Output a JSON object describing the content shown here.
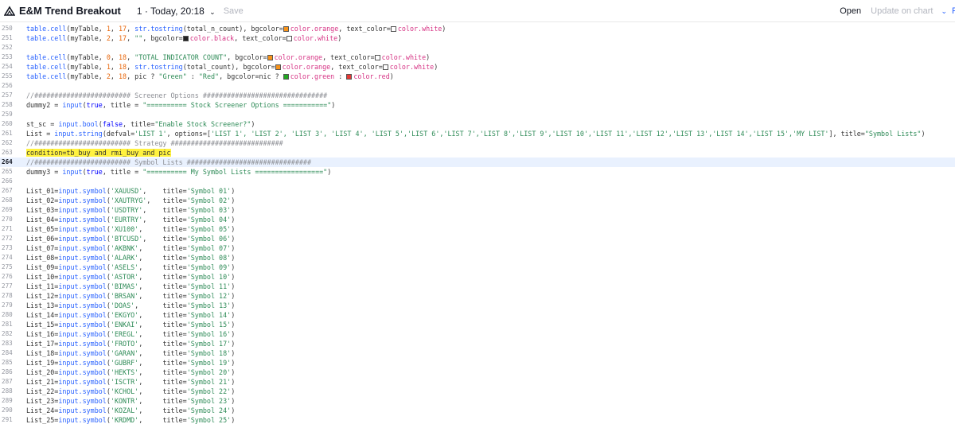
{
  "header": {
    "script_name": "E&M Trend Breakout",
    "version": "1 · Today, 20:18",
    "chevron": "⌄",
    "save_label": "Save",
    "open_label": "Open",
    "update_label": "Update on chart",
    "chevron2": "⌄",
    "publish_label": "P"
  },
  "colors": {
    "accent": "#2962ff",
    "highlight": "#fff23f",
    "current_line": "#e9f1fe"
  },
  "lines": [
    {
      "n": "250",
      "segs": [
        {
          "t": "table.cell",
          "c": "fn"
        },
        {
          "t": "(myTable, "
        },
        {
          "t": "1",
          "c": "num"
        },
        {
          "t": ", "
        },
        {
          "t": "17",
          "c": "num"
        },
        {
          "t": ", "
        },
        {
          "t": "str.tostring",
          "c": "fn"
        },
        {
          "t": "(total_n_count), bgcolor="
        },
        {
          "sw": "orange"
        },
        {
          "t": "color.orange",
          "c": "cv"
        },
        {
          "t": ", text_color="
        },
        {
          "sw": "white"
        },
        {
          "t": "color.white",
          "c": "cv"
        },
        {
          "t": ")"
        }
      ]
    },
    {
      "n": "251",
      "segs": [
        {
          "t": "table.cell",
          "c": "fn"
        },
        {
          "t": "(myTable, "
        },
        {
          "t": "2",
          "c": "num"
        },
        {
          "t": ", "
        },
        {
          "t": "17",
          "c": "num"
        },
        {
          "t": ", "
        },
        {
          "t": "\"\"",
          "c": "str"
        },
        {
          "t": ", bgcolor="
        },
        {
          "sw": "black"
        },
        {
          "t": "color.black",
          "c": "cv"
        },
        {
          "t": ", text_color="
        },
        {
          "sw": "white"
        },
        {
          "t": "color.white",
          "c": "cv"
        },
        {
          "t": ")"
        }
      ]
    },
    {
      "n": "252",
      "segs": []
    },
    {
      "n": "253",
      "segs": [
        {
          "t": "table.cell",
          "c": "fn"
        },
        {
          "t": "(myTable, "
        },
        {
          "t": "0",
          "c": "num"
        },
        {
          "t": ", "
        },
        {
          "t": "18",
          "c": "num"
        },
        {
          "t": ", "
        },
        {
          "t": "\"TOTAL INDICATOR COUNT\"",
          "c": "str"
        },
        {
          "t": ", bgcolor="
        },
        {
          "sw": "orange"
        },
        {
          "t": "color.orange",
          "c": "cv"
        },
        {
          "t": ", text_color="
        },
        {
          "sw": "white"
        },
        {
          "t": "color.white",
          "c": "cv"
        },
        {
          "t": ")"
        }
      ]
    },
    {
      "n": "254",
      "segs": [
        {
          "t": "table.cell",
          "c": "fn"
        },
        {
          "t": "(myTable, "
        },
        {
          "t": "1",
          "c": "num"
        },
        {
          "t": ", "
        },
        {
          "t": "18",
          "c": "num"
        },
        {
          "t": ", "
        },
        {
          "t": "str.tostring",
          "c": "fn"
        },
        {
          "t": "(total_count), bgcolor="
        },
        {
          "sw": "orange"
        },
        {
          "t": "color.orange",
          "c": "cv"
        },
        {
          "t": ", text_color="
        },
        {
          "sw": "white"
        },
        {
          "t": "color.white",
          "c": "cv"
        },
        {
          "t": ")"
        }
      ]
    },
    {
      "n": "255",
      "segs": [
        {
          "t": "table.cell",
          "c": "fn"
        },
        {
          "t": "(myTable, "
        },
        {
          "t": "2",
          "c": "num"
        },
        {
          "t": ", "
        },
        {
          "t": "18",
          "c": "num"
        },
        {
          "t": ", pic ? "
        },
        {
          "t": "\"Green\"",
          "c": "str"
        },
        {
          "t": " : "
        },
        {
          "t": "\"Red\"",
          "c": "str"
        },
        {
          "t": ", bgcolor=nic ? "
        },
        {
          "sw": "green"
        },
        {
          "t": "color.green",
          "c": "cv"
        },
        {
          "t": " : "
        },
        {
          "sw": "red"
        },
        {
          "t": "color.red",
          "c": "cv"
        },
        {
          "t": ")"
        }
      ]
    },
    {
      "n": "256",
      "segs": []
    },
    {
      "n": "257",
      "segs": [
        {
          "t": "//######################## Screener Options ###############################",
          "c": "cmt"
        }
      ]
    },
    {
      "n": "258",
      "segs": [
        {
          "t": "dummy2 = "
        },
        {
          "t": "input",
          "c": "fn"
        },
        {
          "t": "("
        },
        {
          "t": "true",
          "c": "kw"
        },
        {
          "t": ", title = "
        },
        {
          "t": "\"========== Stock Screener Options ===========\"",
          "c": "str"
        },
        {
          "t": ")"
        }
      ]
    },
    {
      "n": "259",
      "segs": []
    },
    {
      "n": "260",
      "segs": [
        {
          "t": "st_sc = "
        },
        {
          "t": "input.bool",
          "c": "fn"
        },
        {
          "t": "("
        },
        {
          "t": "false",
          "c": "kw"
        },
        {
          "t": ", title="
        },
        {
          "t": "\"Enable Stock Screener?\"",
          "c": "str"
        },
        {
          "t": ")"
        }
      ]
    },
    {
      "n": "261",
      "segs": [
        {
          "t": "List = "
        },
        {
          "t": "input.string",
          "c": "fn"
        },
        {
          "t": "(defval="
        },
        {
          "t": "'LIST 1'",
          "c": "str"
        },
        {
          "t": ", options=["
        },
        {
          "t": "'LIST 1', 'LIST 2', 'LIST 3', 'LIST 4', 'LIST 5','LIST 6','LIST 7','LIST 8','LIST 9','LIST 10','LIST 11','LIST 12','LIST 13','LIST 14','LIST 15','MY LIST'",
          "c": "str"
        },
        {
          "t": "], title="
        },
        {
          "t": "\"Symbol Lists\"",
          "c": "str"
        },
        {
          "t": ")"
        }
      ]
    },
    {
      "n": "262",
      "segs": [
        {
          "t": "//######################## Strategy ############################",
          "c": "cmt"
        }
      ]
    },
    {
      "n": "263",
      "segs": [
        {
          "t": "condition=tb_buy and rmi_buy and pic",
          "c": "hl"
        }
      ]
    },
    {
      "n": "264",
      "current": true,
      "segs": [
        {
          "t": "//######################## Symbol Lists ###############################",
          "c": "cmt"
        }
      ]
    },
    {
      "n": "265",
      "segs": [
        {
          "t": "dummy3 = "
        },
        {
          "t": "input",
          "c": "fn"
        },
        {
          "t": "("
        },
        {
          "t": "true",
          "c": "kw"
        },
        {
          "t": ", title = "
        },
        {
          "t": "\"========== My Symbol Lists =================\"",
          "c": "str"
        },
        {
          "t": ")"
        }
      ]
    },
    {
      "n": "266",
      "segs": []
    },
    {
      "n": "267",
      "segs": [
        {
          "t": "List_01="
        },
        {
          "t": "input.symbol",
          "c": "fn"
        },
        {
          "t": "("
        },
        {
          "t": "'XAUUSD'",
          "c": "str"
        },
        {
          "t": ",    title="
        },
        {
          "t": "'Symbol 01'",
          "c": "str"
        },
        {
          "t": ")"
        }
      ]
    },
    {
      "n": "268",
      "segs": [
        {
          "t": "List_02="
        },
        {
          "t": "input.symbol",
          "c": "fn"
        },
        {
          "t": "("
        },
        {
          "t": "'XAUTRYG'",
          "c": "str"
        },
        {
          "t": ",   title="
        },
        {
          "t": "'Symbol 02'",
          "c": "str"
        },
        {
          "t": ")"
        }
      ]
    },
    {
      "n": "269",
      "segs": [
        {
          "t": "List_03="
        },
        {
          "t": "input.symbol",
          "c": "fn"
        },
        {
          "t": "("
        },
        {
          "t": "'USDTRY'",
          "c": "str"
        },
        {
          "t": ",    title="
        },
        {
          "t": "'Symbol 03'",
          "c": "str"
        },
        {
          "t": ")"
        }
      ]
    },
    {
      "n": "270",
      "segs": [
        {
          "t": "List_04="
        },
        {
          "t": "input.symbol",
          "c": "fn"
        },
        {
          "t": "("
        },
        {
          "t": "'EURTRY'",
          "c": "str"
        },
        {
          "t": ",    title="
        },
        {
          "t": "'Symbol 04'",
          "c": "str"
        },
        {
          "t": ")"
        }
      ]
    },
    {
      "n": "271",
      "segs": [
        {
          "t": "List_05="
        },
        {
          "t": "input.symbol",
          "c": "fn"
        },
        {
          "t": "("
        },
        {
          "t": "'XU100'",
          "c": "str"
        },
        {
          "t": ",     title="
        },
        {
          "t": "'Symbol 05'",
          "c": "str"
        },
        {
          "t": ")"
        }
      ]
    },
    {
      "n": "272",
      "segs": [
        {
          "t": "List_06="
        },
        {
          "t": "input.symbol",
          "c": "fn"
        },
        {
          "t": "("
        },
        {
          "t": "'BTCUSD'",
          "c": "str"
        },
        {
          "t": ",    title="
        },
        {
          "t": "'Symbol 06'",
          "c": "str"
        },
        {
          "t": ")"
        }
      ]
    },
    {
      "n": "273",
      "segs": [
        {
          "t": "List_07="
        },
        {
          "t": "input.symbol",
          "c": "fn"
        },
        {
          "t": "("
        },
        {
          "t": "'AKBNK'",
          "c": "str"
        },
        {
          "t": ",     title="
        },
        {
          "t": "'Symbol 07'",
          "c": "str"
        },
        {
          "t": ")"
        }
      ]
    },
    {
      "n": "274",
      "segs": [
        {
          "t": "List_08="
        },
        {
          "t": "input.symbol",
          "c": "fn"
        },
        {
          "t": "("
        },
        {
          "t": "'ALARK'",
          "c": "str"
        },
        {
          "t": ",     title="
        },
        {
          "t": "'Symbol 08'",
          "c": "str"
        },
        {
          "t": ")"
        }
      ]
    },
    {
      "n": "275",
      "segs": [
        {
          "t": "List_09="
        },
        {
          "t": "input.symbol",
          "c": "fn"
        },
        {
          "t": "("
        },
        {
          "t": "'ASELS'",
          "c": "str"
        },
        {
          "t": ",     title="
        },
        {
          "t": "'Symbol 09'",
          "c": "str"
        },
        {
          "t": ")"
        }
      ]
    },
    {
      "n": "276",
      "segs": [
        {
          "t": "List_10="
        },
        {
          "t": "input.symbol",
          "c": "fn"
        },
        {
          "t": "("
        },
        {
          "t": "'ASTOR'",
          "c": "str"
        },
        {
          "t": ",     title="
        },
        {
          "t": "'Symbol 10'",
          "c": "str"
        },
        {
          "t": ")"
        }
      ]
    },
    {
      "n": "277",
      "segs": [
        {
          "t": "List_11="
        },
        {
          "t": "input.symbol",
          "c": "fn"
        },
        {
          "t": "("
        },
        {
          "t": "'BIMAS'",
          "c": "str"
        },
        {
          "t": ",     title="
        },
        {
          "t": "'Symbol 11'",
          "c": "str"
        },
        {
          "t": ")"
        }
      ]
    },
    {
      "n": "278",
      "segs": [
        {
          "t": "List_12="
        },
        {
          "t": "input.symbol",
          "c": "fn"
        },
        {
          "t": "("
        },
        {
          "t": "'BRSAN'",
          "c": "str"
        },
        {
          "t": ",     title="
        },
        {
          "t": "'Symbol 12'",
          "c": "str"
        },
        {
          "t": ")"
        }
      ]
    },
    {
      "n": "279",
      "segs": [
        {
          "t": "List_13="
        },
        {
          "t": "input.symbol",
          "c": "fn"
        },
        {
          "t": "("
        },
        {
          "t": "'DOAS'",
          "c": "str"
        },
        {
          "t": ",      title="
        },
        {
          "t": "'Symbol 13'",
          "c": "str"
        },
        {
          "t": ")"
        }
      ]
    },
    {
      "n": "280",
      "segs": [
        {
          "t": "List_14="
        },
        {
          "t": "input.symbol",
          "c": "fn"
        },
        {
          "t": "("
        },
        {
          "t": "'EKGYO'",
          "c": "str"
        },
        {
          "t": ",     title="
        },
        {
          "t": "'Symbol 14'",
          "c": "str"
        },
        {
          "t": ")"
        }
      ]
    },
    {
      "n": "281",
      "segs": [
        {
          "t": "List_15="
        },
        {
          "t": "input.symbol",
          "c": "fn"
        },
        {
          "t": "("
        },
        {
          "t": "'ENKAI'",
          "c": "str"
        },
        {
          "t": ",     title="
        },
        {
          "t": "'Symbol 15'",
          "c": "str"
        },
        {
          "t": ")"
        }
      ]
    },
    {
      "n": "282",
      "segs": [
        {
          "t": "List_16="
        },
        {
          "t": "input.symbol",
          "c": "fn"
        },
        {
          "t": "("
        },
        {
          "t": "'EREGL'",
          "c": "str"
        },
        {
          "t": ",     title="
        },
        {
          "t": "'Symbol 16'",
          "c": "str"
        },
        {
          "t": ")"
        }
      ]
    },
    {
      "n": "283",
      "segs": [
        {
          "t": "List_17="
        },
        {
          "t": "input.symbol",
          "c": "fn"
        },
        {
          "t": "("
        },
        {
          "t": "'FROTO'",
          "c": "str"
        },
        {
          "t": ",     title="
        },
        {
          "t": "'Symbol 17'",
          "c": "str"
        },
        {
          "t": ")"
        }
      ]
    },
    {
      "n": "284",
      "segs": [
        {
          "t": "List_18="
        },
        {
          "t": "input.symbol",
          "c": "fn"
        },
        {
          "t": "("
        },
        {
          "t": "'GARAN'",
          "c": "str"
        },
        {
          "t": ",     title="
        },
        {
          "t": "'Symbol 18'",
          "c": "str"
        },
        {
          "t": ")"
        }
      ]
    },
    {
      "n": "285",
      "segs": [
        {
          "t": "List_19="
        },
        {
          "t": "input.symbol",
          "c": "fn"
        },
        {
          "t": "("
        },
        {
          "t": "'GUBRF'",
          "c": "str"
        },
        {
          "t": ",     title="
        },
        {
          "t": "'Symbol 19'",
          "c": "str"
        },
        {
          "t": ")"
        }
      ]
    },
    {
      "n": "286",
      "segs": [
        {
          "t": "List_20="
        },
        {
          "t": "input.symbol",
          "c": "fn"
        },
        {
          "t": "("
        },
        {
          "t": "'HEKTS'",
          "c": "str"
        },
        {
          "t": ",     title="
        },
        {
          "t": "'Symbol 20'",
          "c": "str"
        },
        {
          "t": ")"
        }
      ]
    },
    {
      "n": "287",
      "segs": [
        {
          "t": "List_21="
        },
        {
          "t": "input.symbol",
          "c": "fn"
        },
        {
          "t": "("
        },
        {
          "t": "'ISCTR'",
          "c": "str"
        },
        {
          "t": ",     title="
        },
        {
          "t": "'Symbol 21'",
          "c": "str"
        },
        {
          "t": ")"
        }
      ]
    },
    {
      "n": "288",
      "segs": [
        {
          "t": "List_22="
        },
        {
          "t": "input.symbol",
          "c": "fn"
        },
        {
          "t": "("
        },
        {
          "t": "'KCHOL'",
          "c": "str"
        },
        {
          "t": ",     title="
        },
        {
          "t": "'Symbol 22'",
          "c": "str"
        },
        {
          "t": ")"
        }
      ]
    },
    {
      "n": "289",
      "segs": [
        {
          "t": "List_23="
        },
        {
          "t": "input.symbol",
          "c": "fn"
        },
        {
          "t": "("
        },
        {
          "t": "'KONTR'",
          "c": "str"
        },
        {
          "t": ",     title="
        },
        {
          "t": "'Symbol 23'",
          "c": "str"
        },
        {
          "t": ")"
        }
      ]
    },
    {
      "n": "290",
      "segs": [
        {
          "t": "List_24="
        },
        {
          "t": "input.symbol",
          "c": "fn"
        },
        {
          "t": "("
        },
        {
          "t": "'KOZAL'",
          "c": "str"
        },
        {
          "t": ",     title="
        },
        {
          "t": "'Symbol 24'",
          "c": "str"
        },
        {
          "t": ")"
        }
      ]
    },
    {
      "n": "291",
      "segs": [
        {
          "t": "List_25="
        },
        {
          "t": "input.symbol",
          "c": "fn"
        },
        {
          "t": "("
        },
        {
          "t": "'KRDMD'",
          "c": "str"
        },
        {
          "t": ",     title="
        },
        {
          "t": "'Symbol 25'",
          "c": "str"
        },
        {
          "t": ")"
        }
      ]
    }
  ]
}
